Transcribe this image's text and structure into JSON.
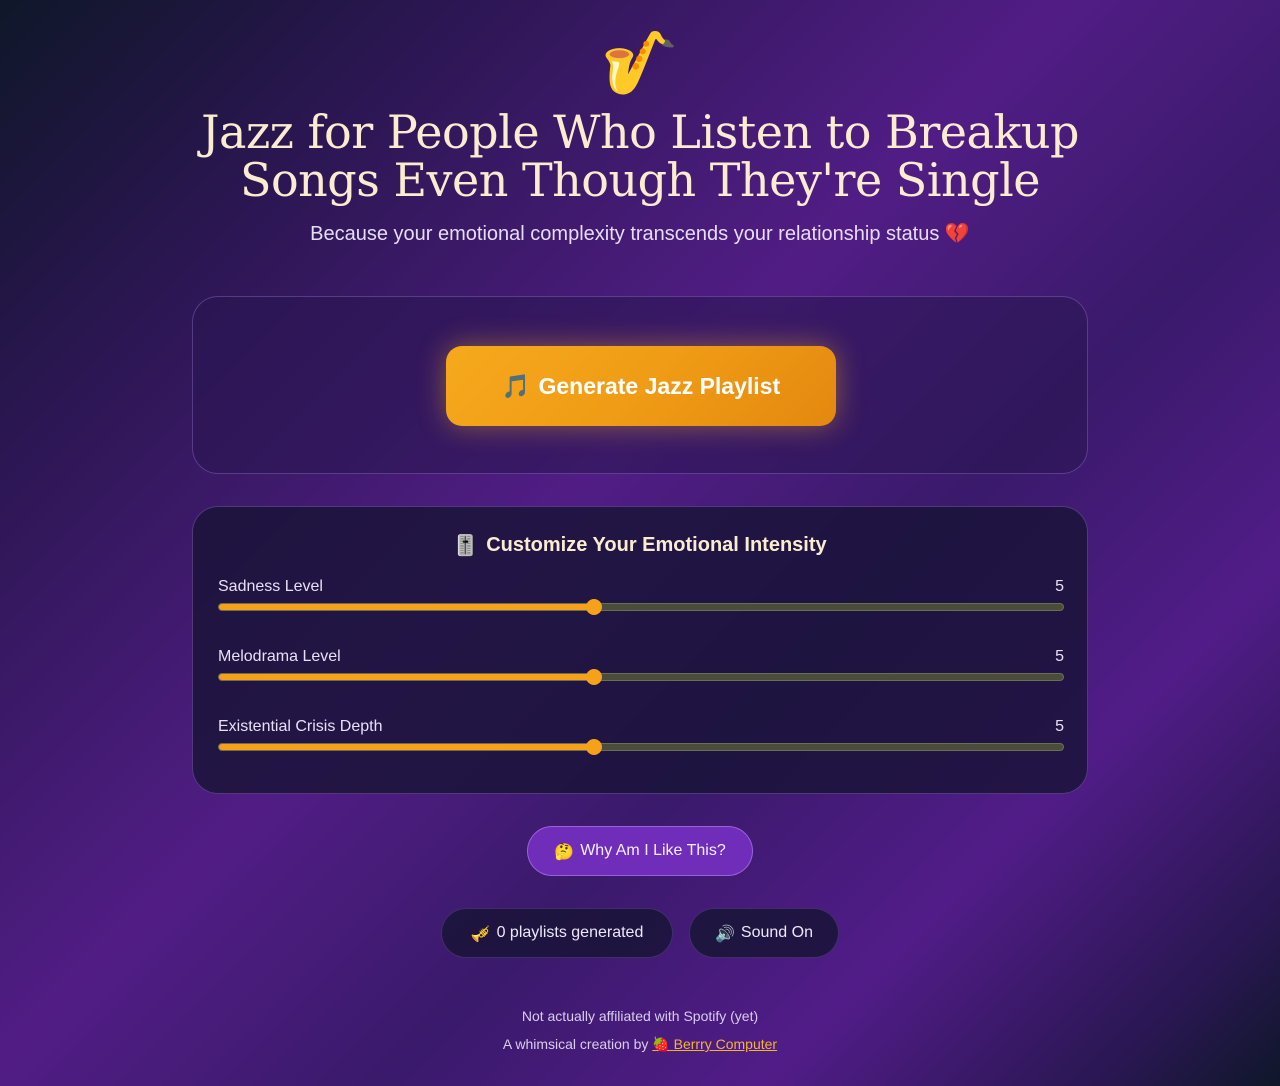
{
  "hero": {
    "icon": "saxophone-icon",
    "icon_glyph": "🎷",
    "title": "Jazz for People Who Listen to Breakup Songs Even Though They're Single",
    "subtitle": "Because your emotional complexity transcends your relationship status 💔"
  },
  "generate": {
    "icon_glyph": "🎵",
    "label": "Generate Jazz Playlist"
  },
  "controls": {
    "heading_icon_glyph": "🎚️",
    "heading": "Customize Your Emotional Intensity",
    "sliders": [
      {
        "label": "Sadness Level",
        "value": 5,
        "min": 1,
        "max": 10
      },
      {
        "label": "Melodrama Level",
        "value": 5,
        "min": 1,
        "max": 10
      },
      {
        "label": "Existential Crisis Depth",
        "value": 5,
        "min": 1,
        "max": 10
      }
    ],
    "accent_color": "#f5a21a"
  },
  "why_button": {
    "icon_glyph": "🤔",
    "label": "Why Am I Like This?"
  },
  "stats": {
    "count_icon_glyph": "🎺",
    "count_label": "0 playlists generated",
    "sound_icon_glyph": "🔊",
    "sound_label": "Sound On"
  },
  "footer": {
    "line1": "Not actually affiliated with Spotify (yet)",
    "line2_prefix": "A whimsical creation by",
    "link_icon_glyph": "🍓",
    "link_label": "Berrry Computer"
  }
}
